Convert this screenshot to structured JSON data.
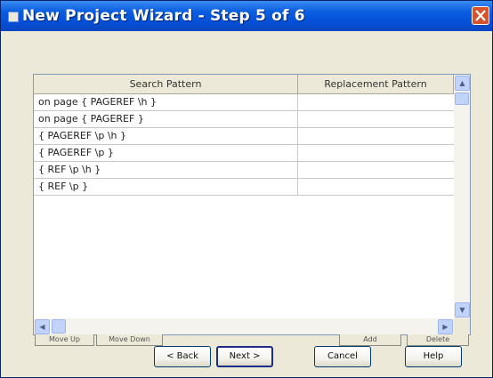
{
  "window": {
    "title": "New Project Wizard - Step 5 of 6"
  },
  "grid": {
    "columns": [
      "Search Pattern",
      "Replacement Pattern"
    ],
    "rows": [
      {
        "search": "on page { PAGEREF \\h }",
        "replacement": ""
      },
      {
        "search": "on page { PAGEREF }",
        "replacement": ""
      },
      {
        "search": "{ PAGEREF \\p \\h }",
        "replacement": ""
      },
      {
        "search": "{ PAGEREF \\p }",
        "replacement": ""
      },
      {
        "search": "{ REF \\p \\h }",
        "replacement": ""
      },
      {
        "search": "{ REF \\p }",
        "replacement": ""
      }
    ]
  },
  "grid_buttons": {
    "move_up": "Move Up",
    "move_down": "Move Down",
    "add": "Add",
    "delete": "Delete"
  },
  "buttons": {
    "back": "< Back",
    "next": "Next >",
    "cancel": "Cancel",
    "help": "Help"
  },
  "colors": {
    "titlebar": "#0550d8",
    "dialog_bg": "#ece9d8",
    "desktop": "#c9632a",
    "close_button": "#d8522c"
  },
  "icons": {
    "app": "wizard-app-icon",
    "close": "close-x-icon",
    "scroll_up": "chevron-up-icon",
    "scroll_down": "chevron-down-icon",
    "scroll_left": "chevron-left-icon",
    "scroll_right": "chevron-right-icon"
  }
}
